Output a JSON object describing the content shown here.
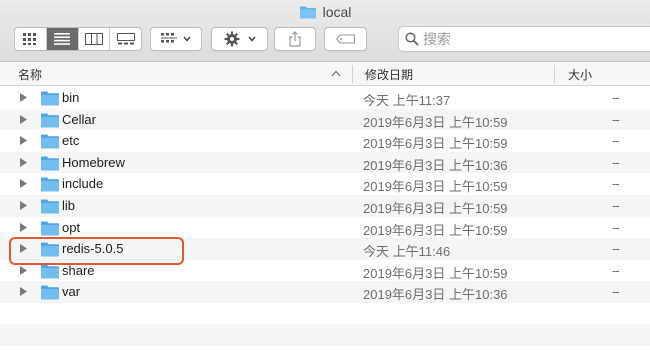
{
  "window": {
    "title": "local",
    "title_icon": "folder-icon"
  },
  "toolbar": {
    "view_modes": [
      "icon-view-icon",
      "list-view-icon",
      "column-view-icon",
      "gallery-view-icon"
    ],
    "active_view": 1,
    "group_icon": "group-by-icon",
    "action_icon": "gear-icon",
    "share_icon": "share-icon",
    "tag_icon": "tag-icon",
    "search_placeholder": "搜索"
  },
  "columns": {
    "name": "名称",
    "modified": "修改日期",
    "size": "大小"
  },
  "files": [
    {
      "name": "bin",
      "modified": "今天 上午11:37",
      "size": "--"
    },
    {
      "name": "Cellar",
      "modified": "2019年6月3日 上午10:59",
      "size": "--"
    },
    {
      "name": "etc",
      "modified": "2019年6月3日 上午10:59",
      "size": "--"
    },
    {
      "name": "Homebrew",
      "modified": "2019年6月3日 上午10:36",
      "size": "--"
    },
    {
      "name": "include",
      "modified": "2019年6月3日 上午10:59",
      "size": "--"
    },
    {
      "name": "lib",
      "modified": "2019年6月3日 上午10:59",
      "size": "--"
    },
    {
      "name": "opt",
      "modified": "2019年6月3日 上午10:59",
      "size": "--"
    },
    {
      "name": "redis-5.0.5",
      "modified": "今天 上午11:46",
      "size": "--"
    },
    {
      "name": "share",
      "modified": "2019年6月3日 上午10:59",
      "size": "--"
    },
    {
      "name": "var",
      "modified": "2019年6月3日 上午10:36",
      "size": "--"
    }
  ],
  "highlighted_item": "redis-5.0.5",
  "colors": {
    "folder": "#5fb3ee",
    "highlight": "#e2582f"
  }
}
